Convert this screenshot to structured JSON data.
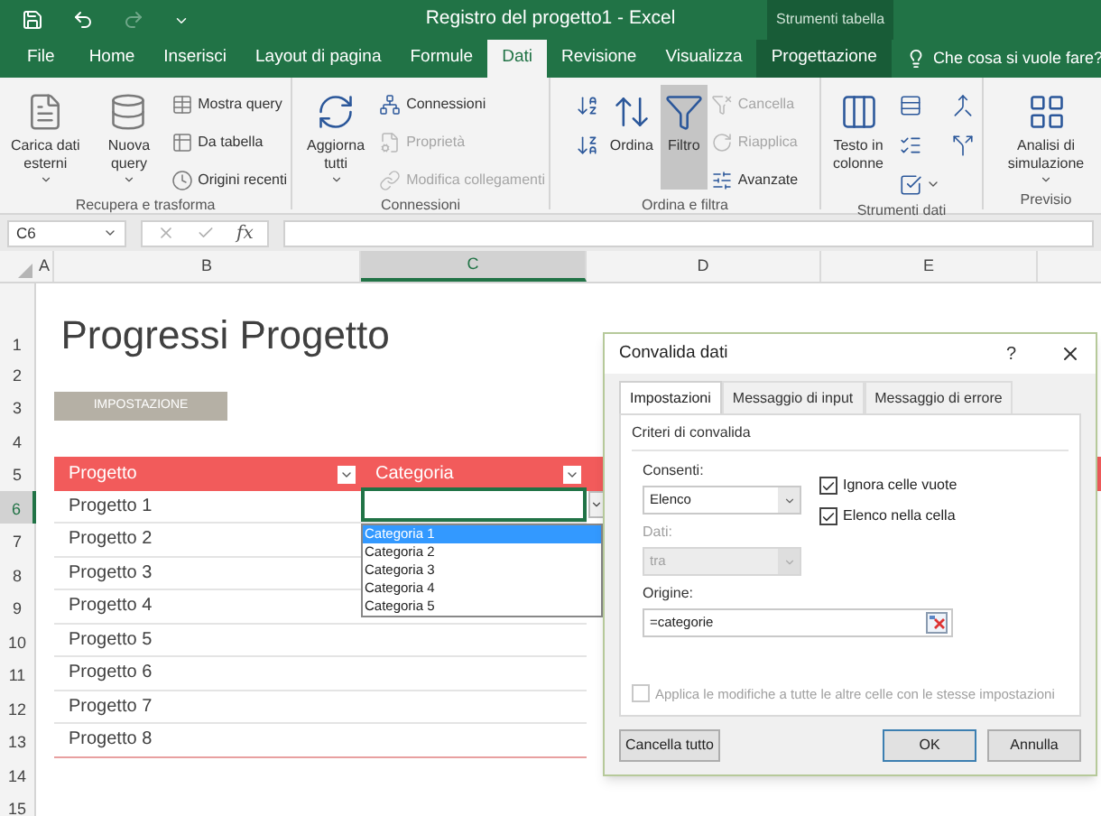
{
  "title_bar": {
    "title": "Registro del progetto1 - Excel",
    "context_label": "Strumenti tabella"
  },
  "tabs": [
    {
      "label": "File",
      "selected": false,
      "kind": "normal"
    },
    {
      "label": "Home",
      "selected": false,
      "kind": "normal"
    },
    {
      "label": "Inserisci",
      "selected": false,
      "kind": "normal"
    },
    {
      "label": "Layout di pagina",
      "selected": false,
      "kind": "normal"
    },
    {
      "label": "Formule",
      "selected": false,
      "kind": "normal"
    },
    {
      "label": "Dati",
      "selected": true,
      "kind": "normal"
    },
    {
      "label": "Revisione",
      "selected": false,
      "kind": "normal"
    },
    {
      "label": "Visualizza",
      "selected": false,
      "kind": "normal"
    },
    {
      "label": "Progettazione",
      "selected": false,
      "kind": "contextual"
    }
  ],
  "tell_me": "Che cosa si vuole fare?",
  "ribbon": {
    "groups": [
      {
        "label": "Recupera e trasforma",
        "buttons": [
          {
            "kind": "large",
            "label": "Carica dati esterni",
            "menu": true,
            "disabled": false,
            "pressed": false
          },
          {
            "kind": "large",
            "label": "Nuova query",
            "menu": true,
            "disabled": false,
            "pressed": false
          },
          {
            "kind": "small",
            "label": "Mostra query",
            "menu": false,
            "disabled": false,
            "pressed": false
          },
          {
            "kind": "small",
            "label": "Da tabella",
            "menu": false,
            "disabled": false,
            "pressed": false
          },
          {
            "kind": "small",
            "label": "Origini recenti",
            "menu": false,
            "disabled": false,
            "pressed": false
          }
        ]
      },
      {
        "label": "Connessioni",
        "buttons": [
          {
            "kind": "large",
            "label": "Aggiorna tutti",
            "menu": true,
            "disabled": false,
            "pressed": false
          },
          {
            "kind": "small",
            "label": "Connessioni",
            "menu": false,
            "disabled": false,
            "pressed": false
          },
          {
            "kind": "small",
            "label": "Proprietà",
            "menu": false,
            "disabled": true,
            "pressed": false
          },
          {
            "kind": "small",
            "label": "Modifica collegamenti",
            "menu": false,
            "disabled": true,
            "pressed": false
          }
        ]
      },
      {
        "label": "Ordina e filtra",
        "buttons": [
          {
            "kind": "icon",
            "menu": false,
            "disabled": false,
            "pressed": false
          },
          {
            "kind": "icon",
            "menu": false,
            "disabled": false,
            "pressed": false
          },
          {
            "kind": "large",
            "label": "Ordina",
            "menu": false,
            "disabled": false,
            "pressed": false
          },
          {
            "kind": "large",
            "label": "Filtro",
            "menu": false,
            "disabled": false,
            "pressed": true
          },
          {
            "kind": "small",
            "label": "Cancella",
            "menu": false,
            "disabled": true,
            "pressed": false
          },
          {
            "kind": "small",
            "label": "Riapplica",
            "menu": false,
            "disabled": true,
            "pressed": false
          },
          {
            "kind": "small",
            "label": "Avanzate",
            "menu": false,
            "disabled": false,
            "pressed": false
          }
        ]
      },
      {
        "label": "Strumenti dati",
        "buttons": [
          {
            "kind": "large",
            "label": "Testo in colonne",
            "menu": false,
            "disabled": false,
            "pressed": false
          },
          {
            "kind": "icon",
            "menu": false,
            "disabled": false,
            "pressed": false
          },
          {
            "kind": "icon",
            "menu": false,
            "disabled": false,
            "pressed": false
          },
          {
            "kind": "icon",
            "menu": true,
            "disabled": false,
            "pressed": false
          },
          {
            "kind": "icon",
            "menu": false,
            "disabled": false,
            "pressed": false
          },
          {
            "kind": "icon",
            "menu": false,
            "disabled": false,
            "pressed": false
          }
        ]
      },
      {
        "label": "Previsio",
        "buttons": [
          {
            "kind": "large",
            "label": "Analisi di simulazione",
            "menu": true,
            "disabled": false,
            "pressed": false
          }
        ]
      }
    ]
  },
  "formula_bar": {
    "name_box": "C6",
    "fx": "fx"
  },
  "sheet": {
    "columns": [
      {
        "label": "A",
        "selected": false
      },
      {
        "label": "B",
        "selected": false
      },
      {
        "label": "C",
        "selected": true
      },
      {
        "label": "D",
        "selected": false
      },
      {
        "label": "E",
        "selected": false
      }
    ],
    "rows": [
      {
        "label": "1",
        "selected": false
      },
      {
        "label": "2",
        "selected": false
      },
      {
        "label": "3",
        "selected": false
      },
      {
        "label": "4",
        "selected": false
      },
      {
        "label": "5",
        "selected": false
      },
      {
        "label": "6",
        "selected": true
      },
      {
        "label": "7",
        "selected": false
      },
      {
        "label": "8",
        "selected": false
      },
      {
        "label": "9",
        "selected": false
      },
      {
        "label": "10",
        "selected": false
      },
      {
        "label": "11",
        "selected": false
      },
      {
        "label": "12",
        "selected": false
      },
      {
        "label": "13",
        "selected": false
      },
      {
        "label": "14",
        "selected": false
      },
      {
        "label": "15",
        "selected": false
      }
    ],
    "title": "Progressi Progetto",
    "button": "IMPOSTAZIONE",
    "table": {
      "headers": [
        "Progetto",
        "Categoria"
      ],
      "rows": [
        "Progetto 1",
        "Progetto 2",
        "Progetto 3",
        "Progetto 4",
        "Progetto 5",
        "Progetto 6",
        "Progetto 7",
        "Progetto 8"
      ]
    },
    "dropdown": [
      {
        "label": "Categoria 1",
        "selected": true
      },
      {
        "label": "Categoria 2",
        "selected": false
      },
      {
        "label": "Categoria 3",
        "selected": false
      },
      {
        "label": "Categoria 4",
        "selected": false
      },
      {
        "label": "Categoria 5",
        "selected": false
      }
    ]
  },
  "dialog": {
    "title": "Convalida dati",
    "help": "?",
    "tabs": [
      {
        "label": "Impostazioni",
        "selected": true
      },
      {
        "label": "Messaggio di input",
        "selected": false
      },
      {
        "label": "Messaggio di errore",
        "selected": false
      }
    ],
    "section": "Criteri di convalida",
    "allow_label": "Consenti:",
    "allow_value": "Elenco",
    "data_label": "Dati:",
    "data_value": "tra",
    "data_disabled": true,
    "source_label": "Origine:",
    "source_value": "=categorie",
    "checkboxes": [
      {
        "label": "Ignora celle vuote",
        "checked": true,
        "disabled": false
      },
      {
        "label": "Elenco nella cella",
        "checked": true,
        "disabled": false
      }
    ],
    "apply_all": {
      "label": "Applica le modifiche a tutte le altre celle con le stesse impostazioni",
      "checked": false,
      "disabled": true
    },
    "buttons": [
      {
        "label": "Cancella tutto",
        "kind": "left"
      },
      {
        "label": "OK",
        "kind": "default"
      },
      {
        "label": "Annulla",
        "kind": "normal"
      }
    ]
  }
}
